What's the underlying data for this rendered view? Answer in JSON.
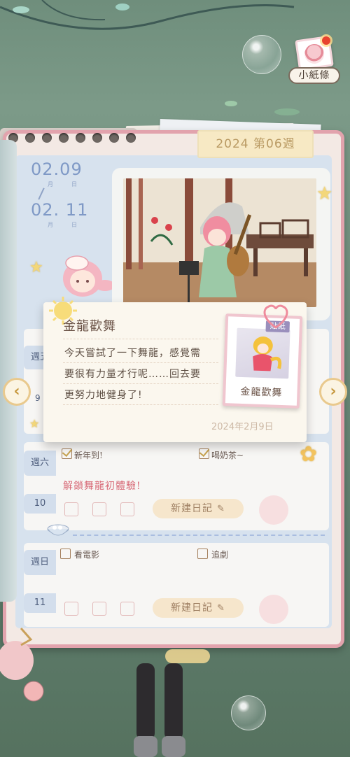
{
  "header": {
    "note_button_label": "小紙條"
  },
  "week": {
    "label": "2024 第06週"
  },
  "date_range": {
    "start": {
      "date": "02.09",
      "month_label": "月",
      "day_label": "日"
    },
    "end": {
      "date": "02. 11",
      "month_label": "月",
      "day_label": "日"
    }
  },
  "days": [
    {
      "weekday": "週五",
      "day": "9"
    },
    {
      "weekday": "週六",
      "day": "10",
      "checklist": [
        {
          "text": "新年到!",
          "checked": true
        },
        {
          "text": "喝奶茶~",
          "checked": true
        }
      ],
      "highlight": "解鎖舞龍初體驗!",
      "new_entry_label": "新建日記"
    },
    {
      "weekday": "週日",
      "day": "11",
      "checklist": [
        {
          "text": "看電影",
          "checked": false
        },
        {
          "text": "追劇",
          "checked": false
        }
      ],
      "new_entry_label": "新建日記"
    }
  ],
  "popup": {
    "title": "金龍歡舞",
    "body_lines": [
      "今天嘗試了一下舞龍，感覺需",
      "要很有力量才行呢……回去要",
      "更努力地健身了!"
    ],
    "date": "2024年2月9日",
    "sticker": {
      "badge": "貼紙",
      "name": "金龍歡舞"
    }
  },
  "navigation": {
    "prev_icon": "chevron-left-icon",
    "next_icon": "chevron-right-icon"
  },
  "colors": {
    "binder_border": "#e2a3ad",
    "inner_page": "#d7e2ee",
    "date_blue": "#7f99c6",
    "highlight_red": "#d86b78",
    "week_tag": "#f7e9c4"
  }
}
